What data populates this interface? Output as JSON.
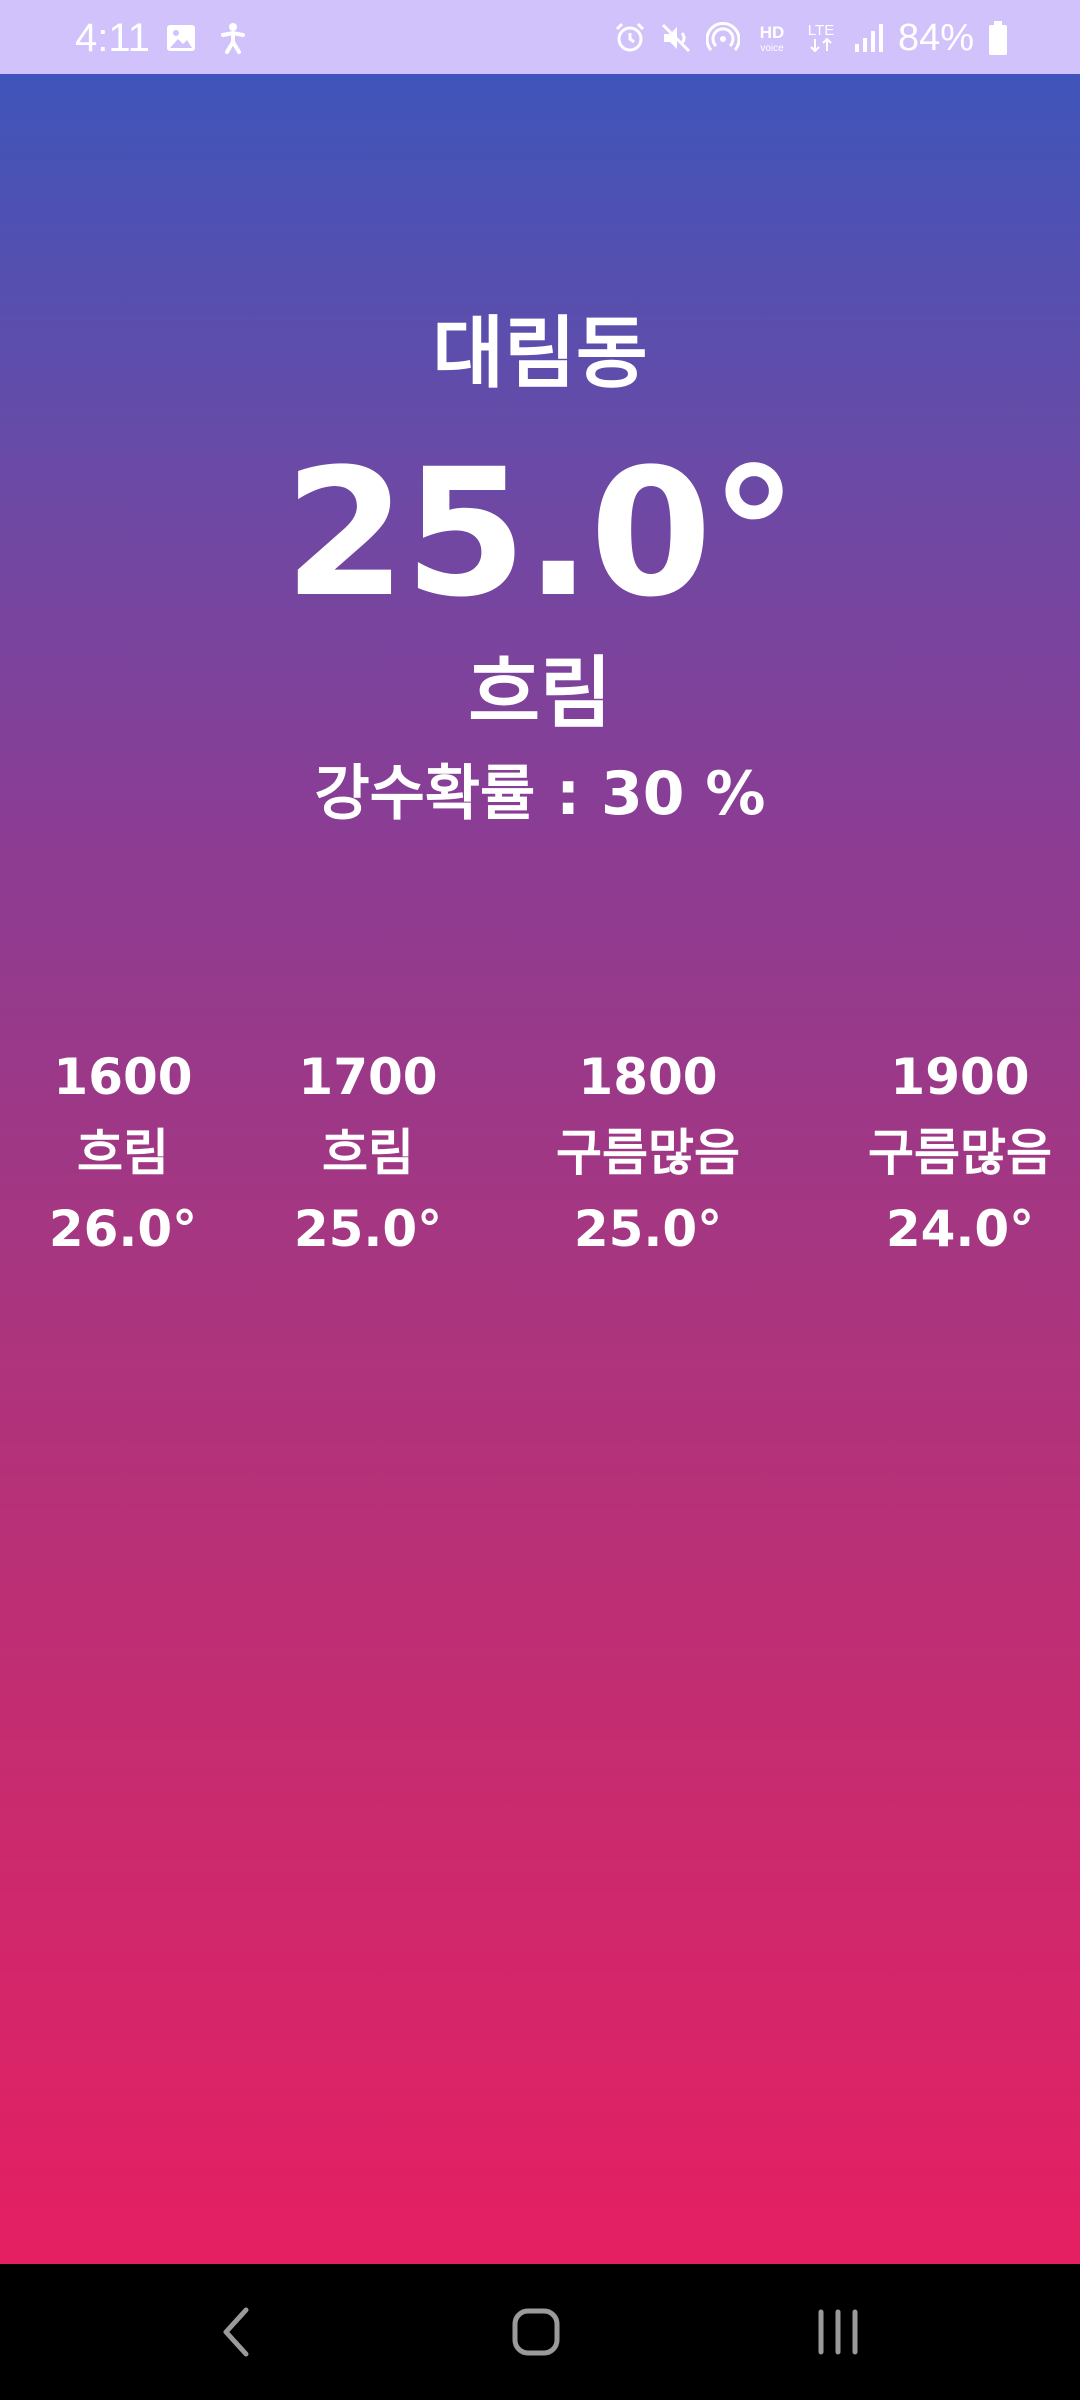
{
  "status_bar": {
    "time": "4:11",
    "battery": "84%",
    "network": "LTE",
    "hd_label": "HD",
    "icons": [
      "gallery-icon",
      "accessibility-icon",
      "alarm-icon",
      "mute-icon",
      "hotspot-icon",
      "hd-voice-icon",
      "lte-icon",
      "signal-icon",
      "battery-icon"
    ]
  },
  "weather": {
    "location": "대림동",
    "temperature": "25.0°",
    "condition": "흐림",
    "precipitation": "강수확률 : 30 %"
  },
  "forecast": [
    {
      "time": "1600",
      "condition": "흐림",
      "temp": "26.0°"
    },
    {
      "time": "1700",
      "condition": "흐림",
      "temp": "25.0°"
    },
    {
      "time": "1800",
      "condition": "구름많음",
      "temp": "25.0°"
    },
    {
      "time": "1900",
      "condition": "구름많음",
      "temp": "24.0°"
    }
  ],
  "nav_bar": {
    "buttons": [
      "back-icon",
      "home-icon",
      "recents-icon"
    ]
  },
  "colors": {
    "status_bar_bg": "#d1c2fb",
    "gradient_top": "#3f55ba",
    "gradient_bottom": "#e51f62",
    "text": "#ffffff",
    "nav_bg": "#000000"
  }
}
